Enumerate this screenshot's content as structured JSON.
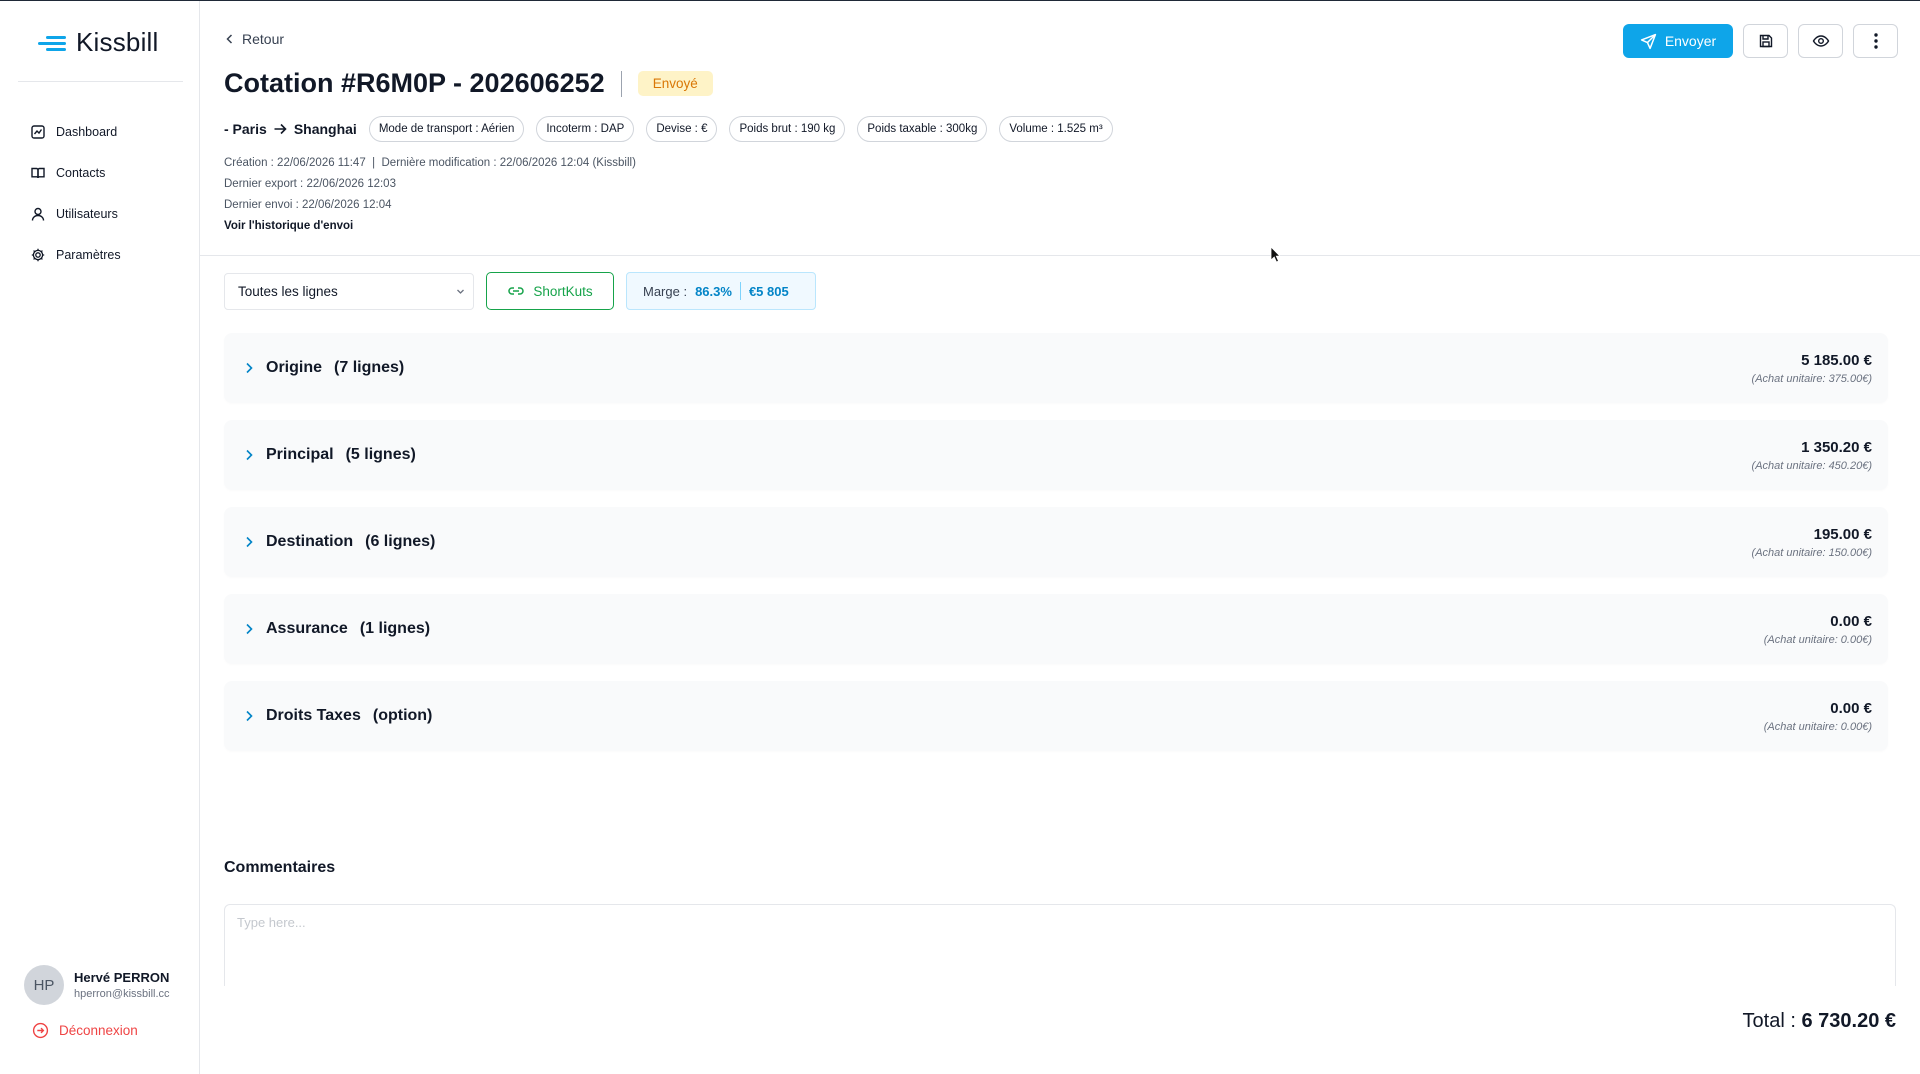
{
  "app": {
    "name": "Kissbill"
  },
  "sidebar": {
    "items": [
      {
        "label": "Dashboard",
        "icon": "dashboard-icon"
      },
      {
        "label": "Contacts",
        "icon": "book-icon"
      },
      {
        "label": "Utilisateurs",
        "icon": "user-icon"
      },
      {
        "label": "Paramètres",
        "icon": "gear-icon"
      }
    ],
    "user": {
      "initials": "HP",
      "name": "Hervé PERRON",
      "email": "hperron@kissbill.cc"
    },
    "logout_label": "Déconnexion"
  },
  "header": {
    "back_label": "Retour",
    "title": "Cotation #R6M0P - 202606252",
    "status": "Envoyé",
    "route": {
      "from": "- Paris",
      "to": "Shanghai"
    },
    "chips": [
      "Mode de transport : Aérien",
      "Incoterm : DAP",
      "Devise : €",
      "Poids brut : 190 kg",
      "Poids taxable : 300kg",
      "Volume : 1.525 m³"
    ],
    "meta": {
      "line1": "Création : 22/06/2026 11:47  |  Dernière modification : 22/06/2026 12:04 (Kissbill)",
      "line2": "Dernier export : 22/06/2026 12:03",
      "line3": "Dernier envoi : 22/06/2026 12:04",
      "history_link": "Voir l'historique d'envoi"
    },
    "actions": {
      "send_label": "Envoyer"
    }
  },
  "toolbar": {
    "filter_value": "Toutes les lignes",
    "shortkuts_label": "ShortKuts",
    "marge_label": "Marge :",
    "marge_percent": "86.3%",
    "marge_amount": "€5 805"
  },
  "sections": [
    {
      "name": "Origine",
      "count": "(7 lignes)",
      "amount": "5 185.00 €",
      "unit": "(Achat unitaire: 375.00€)"
    },
    {
      "name": "Principal",
      "count": "(5 lignes)",
      "amount": "1 350.20 €",
      "unit": "(Achat unitaire: 450.20€)"
    },
    {
      "name": "Destination",
      "count": "(6 lignes)",
      "amount": "195.00 €",
      "unit": "(Achat unitaire: 150.00€)"
    },
    {
      "name": "Assurance",
      "count": "(1 lignes)",
      "amount": "0.00 €",
      "unit": "(Achat unitaire: 0.00€)"
    },
    {
      "name": "Droits Taxes",
      "count": "(option)",
      "amount": "0.00 €",
      "unit": "(Achat unitaire: 0.00€)"
    }
  ],
  "comments": {
    "label": "Commentaires",
    "placeholder": "Type here..."
  },
  "total": {
    "label": "Total :",
    "value": "6 730.20 €"
  },
  "colors": {
    "accent": "#0ea5e9",
    "success": "#16a34a",
    "danger": "#ef4444",
    "badge_bg": "#fef3c7",
    "badge_text": "#d97706"
  }
}
